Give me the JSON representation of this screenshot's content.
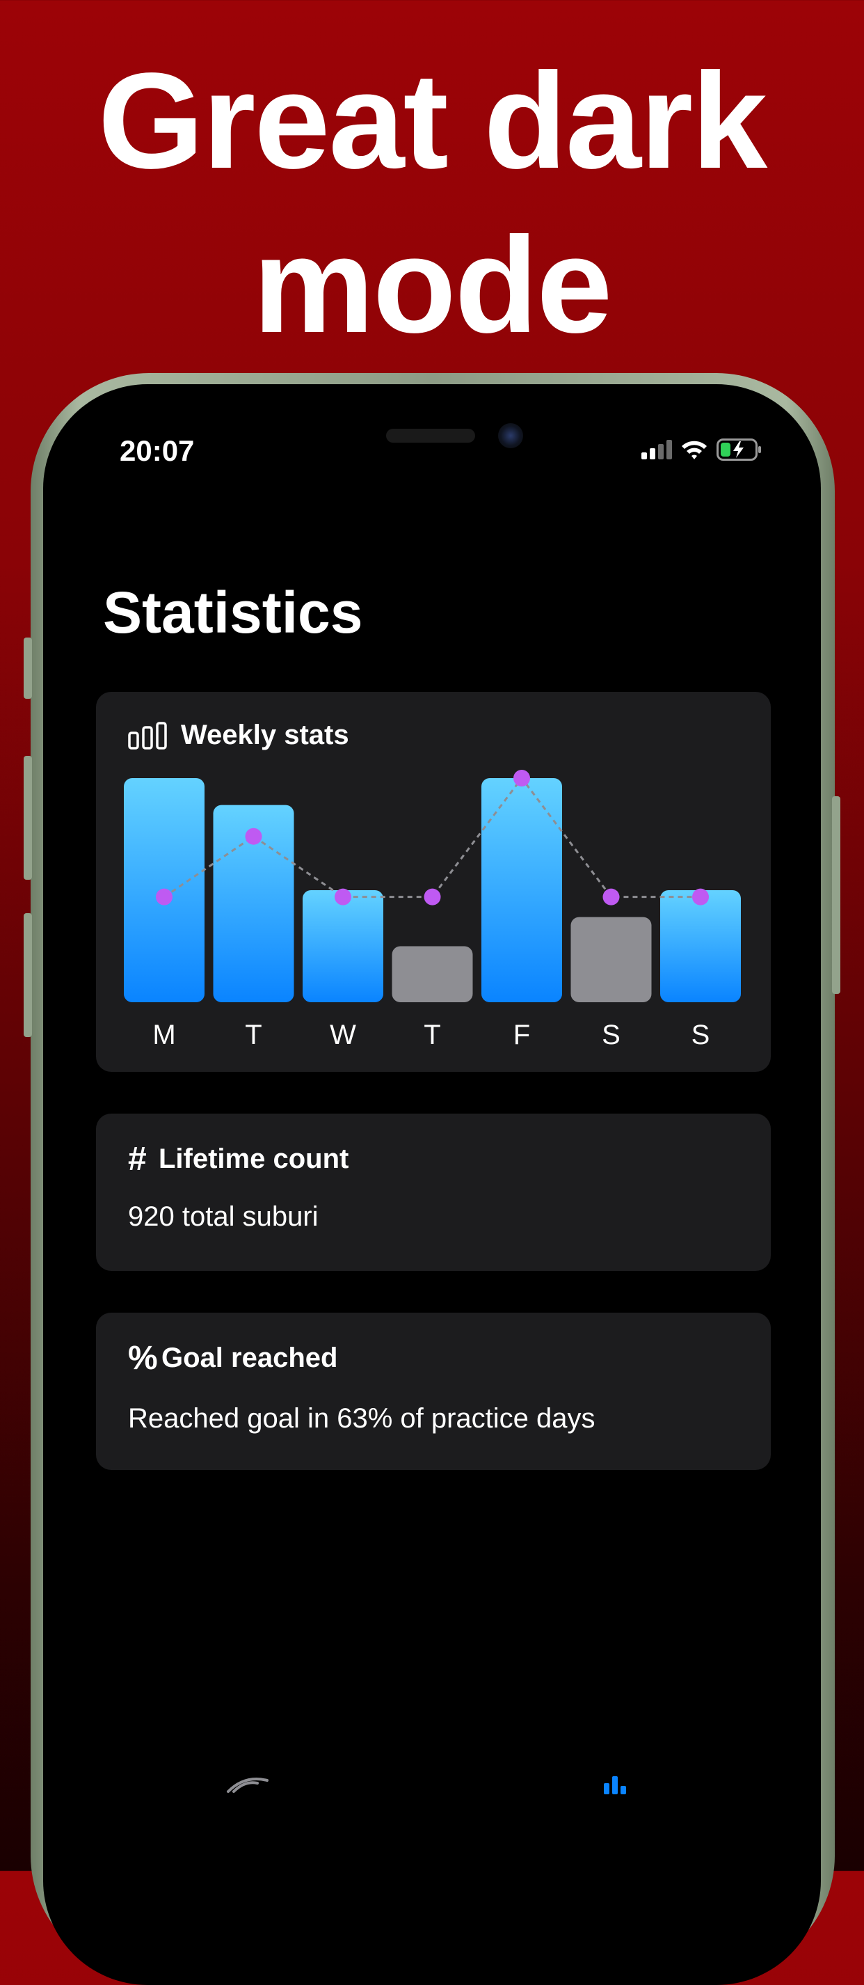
{
  "headline": {
    "line1": "Great dark",
    "line2": "mode"
  },
  "status_bar": {
    "time": "20:07",
    "icons": [
      "cellular-signal-icon",
      "wifi-icon",
      "battery-charging-icon"
    ]
  },
  "page": {
    "title": "Statistics"
  },
  "weekly_card": {
    "title": "Weekly stats",
    "icon": "bar-chart-icon"
  },
  "chart_data": {
    "type": "bar",
    "categories": [
      "M",
      "T",
      "W",
      "T",
      "F",
      "S",
      "S"
    ],
    "series": [
      {
        "values": [
          100,
          88,
          50,
          25,
          100,
          38,
          50
        ],
        "colors": [
          "gradient-blue",
          "gradient-blue",
          "gradient-blue",
          "gray",
          "gradient-blue",
          "gray",
          "gradient-blue"
        ]
      },
      {
        "values": [
          47,
          74,
          47,
          47,
          100,
          47,
          47
        ],
        "style": "dashed-line-with-dots",
        "color": "#bf5af2"
      }
    ],
    "bar_color_top": "#64d2ff",
    "bar_color_bottom": "#0a84ff",
    "bar_color_gray": "#8e8e93",
    "line_color": "#bf5af2",
    "grid": false,
    "ylim": [
      0,
      100
    ]
  },
  "lifetime_card": {
    "icon": "hash-icon",
    "icon_glyph": "#",
    "title": "Lifetime count",
    "text": "920 total suburi"
  },
  "goal_card": {
    "icon": "percent-icon",
    "icon_glyph": "%",
    "title": "Goal reached",
    "text": "Reached goal in 63% of practice days"
  },
  "tab_bar": {
    "items": [
      "practice-tab-icon",
      "statistics-tab-icon"
    ],
    "selected": "statistics-tab-icon"
  },
  "colors": {
    "background": "#9c0307",
    "card": "#1c1c1e",
    "accent": "#0a84ff",
    "dot": "#bf5af2"
  }
}
